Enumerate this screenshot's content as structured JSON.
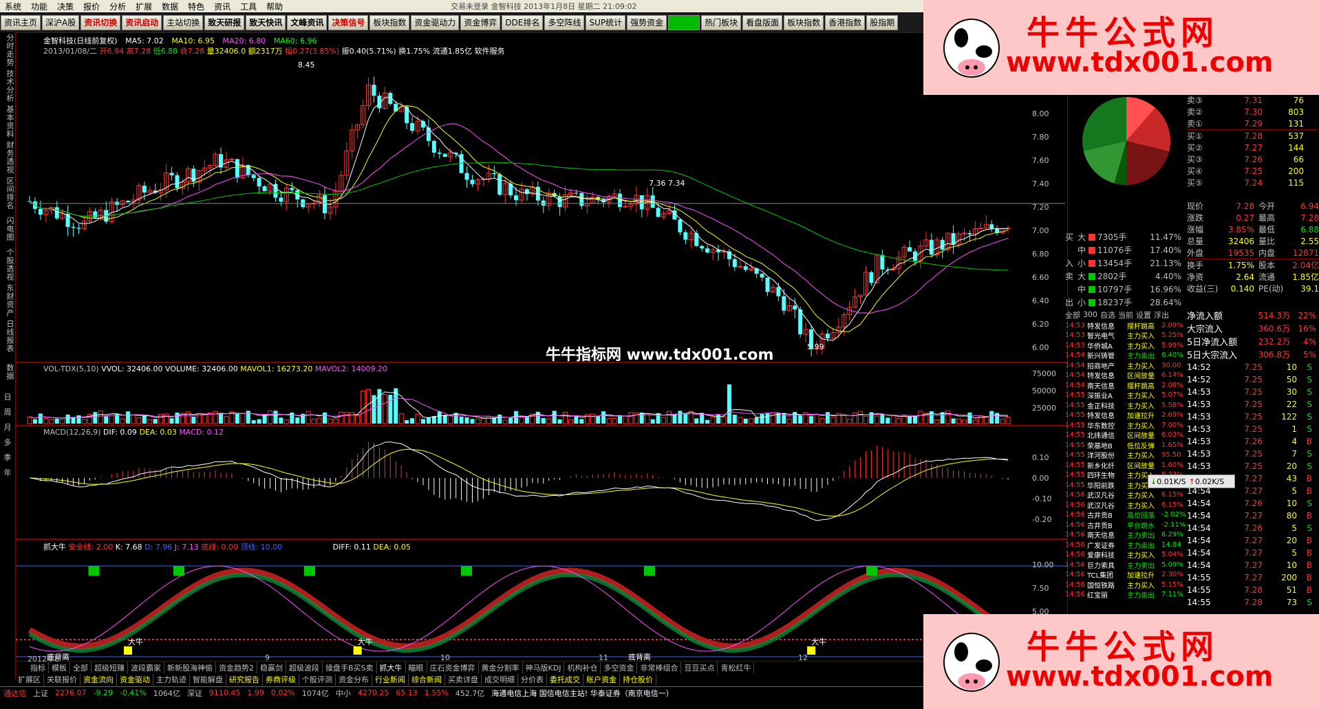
{
  "menu": [
    "系统",
    "功能",
    "决策",
    "报价",
    "分析",
    "扩展",
    "数据",
    "特色",
    "资讯",
    "工具",
    "帮助"
  ],
  "window_title": "交易未登录  金智科技 2013年1月8日 星期二 21:09:02",
  "toolbar": [
    {
      "label": "资讯主页",
      "style": ""
    },
    {
      "label": "深沪A股",
      "style": ""
    },
    {
      "label": "资讯切换",
      "style": "red"
    },
    {
      "label": "资讯启动",
      "style": "red"
    },
    {
      "label": "主站切换",
      "style": ""
    },
    {
      "label": "致天研报",
      "style": "bold"
    },
    {
      "label": "致天快讯",
      "style": "bold"
    },
    {
      "label": "文峰资讯",
      "style": "bold"
    },
    {
      "label": "决策信号",
      "style": "red"
    },
    {
      "label": "板块指数",
      "style": ""
    },
    {
      "label": "资金驱动力",
      "style": ""
    },
    {
      "label": "资金博弈",
      "style": ""
    },
    {
      "label": "DDE排名",
      "style": ""
    },
    {
      "label": "多空阵线",
      "style": ""
    },
    {
      "label": "SUP统计",
      "style": ""
    },
    {
      "label": "强势资金",
      "style": ""
    },
    {
      "label": "",
      "style": "green"
    },
    {
      "label": "热门板块",
      "style": ""
    },
    {
      "label": "看盘版面",
      "style": ""
    },
    {
      "label": "板块指数",
      "style": ""
    },
    {
      "label": "香港指数",
      "style": ""
    },
    {
      "label": "股指期",
      "style": ""
    }
  ],
  "left_tools": [
    "分时走势",
    "技术分析",
    "基本资料",
    "财务透视",
    "区间排名",
    "闪电图",
    "个股透视",
    "东财资产",
    "日线报表",
    "数据"
  ],
  "left_period": [
    "日",
    "周",
    "月",
    "多",
    "季",
    "年"
  ],
  "kline": {
    "title": "金智科技(日线前复权)",
    "ma5": "MA5: 7.02",
    "ma10": "MA10: 6.95",
    "ma20": "MA20: 6.80",
    "ma60": "MA60: 6.96",
    "line2a": "2013/01/08/二",
    "open": "开6.94",
    "high": "高7.28",
    "low": "低6.88",
    "close": "收7.28",
    "vol": "量32406.0",
    "amount": "额2317万",
    "change": "幅0.27(3.85%)",
    "tail": "振0.40(5.71%) 换1.75% 流通1.85亿 软件服务",
    "label_high": "8.45",
    "label_mid": "7.36  7.34",
    "label_low": "5.99",
    "yaxis": [
      "8.00",
      "7.80",
      "7.60",
      "7.40",
      "7.20",
      "7.00",
      "6.80",
      "6.60",
      "6.40",
      "6.20",
      "6.00"
    ]
  },
  "center_watermark": "牛牛指标网 www.tdx001.com",
  "vol": {
    "title": "VOL-TDX(5,10)",
    "v1": "VVOL: 32406.00",
    "v2": "VOLUME: 32406.00",
    "v3": "MAVOL1: 16273.20",
    "v4": "MAVOL2: 14009.20",
    "yaxis": [
      "75000",
      "50000",
      "25000"
    ]
  },
  "macd": {
    "title": "MACD(12,26,9)",
    "dif": "DIF: 0.09",
    "dea": "DEA: 0.03",
    "macd": "MACD: 0.12",
    "yaxis": [
      "0.10",
      "0.00",
      "-0.10",
      "-0.20"
    ]
  },
  "kdj": {
    "title": "抓大牛",
    "safe": "安全线: 2.00",
    "k": "K: 7.68",
    "d": "D: 7.96",
    "j": "J: 7.13",
    "bottom": "底线: 0.00",
    "top": "顶线: 10.00",
    "diff": "DIFF: 0.11",
    "dea": "DEA: 0.05",
    "yaxis": [
      "10.00",
      "7.50",
      "5.00"
    ],
    "sig_bottom": "底背离",
    "sig_buy": "大牛",
    "sig_sell": "卖"
  },
  "xaxis": [
    "2012年8",
    "9",
    "10",
    "11",
    "12"
  ],
  "tabs1": [
    "指标",
    "模板",
    "全部",
    "超级短赚",
    "波段霸家",
    "新新股海神偷",
    "资金趋势2",
    "稳赢剑",
    "超级波段",
    "操盘手B买S卖",
    "抓大牛",
    "瞄眼",
    "庄石资金博弈",
    "黄金分割率",
    "神马版KDJ",
    "机构补仓",
    "多空资金",
    "非常棒组合",
    "豆豆买点",
    "青松红牛"
  ],
  "tabs2": [
    "扩展区",
    "关联报价",
    "资金流向",
    "资金驱动",
    "主力轨迹",
    "智能解盘",
    "研究报告",
    "券商评级",
    "个股评测",
    "资金分布",
    "行业新闻",
    "综合新闻",
    "买卖详盘",
    "成交明细",
    "分价表",
    "委托成交",
    "账户资金",
    "持仓股价"
  ],
  "status": [
    {
      "t": "通达信",
      "c": "red"
    },
    {
      "t": "上证",
      "c": ""
    },
    {
      "t": "2276.07",
      "c": "red"
    },
    {
      "t": "-9.29",
      "c": "green"
    },
    {
      "t": "-0.41%",
      "c": "green"
    },
    {
      "t": "1064亿",
      "c": ""
    },
    {
      "t": "深证",
      "c": ""
    },
    {
      "t": "9110.45",
      "c": "red"
    },
    {
      "t": "1.99",
      "c": "red"
    },
    {
      "t": "0.02%",
      "c": "red"
    },
    {
      "t": "1074亿",
      "c": ""
    },
    {
      "t": "中小",
      "c": ""
    },
    {
      "t": "4270.25",
      "c": "red"
    },
    {
      "t": "65.13",
      "c": "red"
    },
    {
      "t": "1.55%",
      "c": "red"
    },
    {
      "t": "452.7亿",
      "c": ""
    },
    {
      "t": "海通电信上海 国信电信主站! 华泰证券（南京电信一）",
      "c": "white"
    }
  ],
  "pie": {
    "colors": [
      "#ff5050",
      "#c82828",
      "#781414",
      "#0a5a0a",
      "#329632",
      "#14781e"
    ]
  },
  "orderbook": {
    "sell": [
      {
        "l": "卖③",
        "p": "7.31",
        "v": "76"
      },
      {
        "l": "卖②",
        "p": "7.30",
        "v": "803"
      },
      {
        "l": "卖①",
        "p": "7.29",
        "v": "131"
      }
    ],
    "buy": [
      {
        "l": "买①",
        "p": "7.28",
        "v": "537"
      },
      {
        "l": "买②",
        "p": "7.27",
        "v": "144"
      },
      {
        "l": "买③",
        "p": "7.26",
        "v": "66"
      },
      {
        "l": "买④",
        "p": "7.25",
        "v": "200"
      },
      {
        "l": "买⑤",
        "p": "7.24",
        "v": "115"
      }
    ]
  },
  "quote": [
    [
      "现价",
      "7.28",
      "今开",
      "6.94"
    ],
    [
      "涨跌",
      "0.27",
      "最高",
      "7.28"
    ],
    [
      "涨幅",
      "3.85%",
      "最低",
      "6.88"
    ],
    [
      "总量",
      "32406",
      "量比",
      "2.55"
    ],
    [
      "外盘",
      "19535",
      "内盘",
      "12871"
    ],
    [
      "换手",
      "1.75%",
      "股本",
      "2.04亿"
    ],
    [
      "净资",
      "2.64",
      "流通",
      "1.85亿"
    ],
    [
      "收益(三)",
      "0.140",
      "PE(动)",
      "39.1"
    ]
  ],
  "flows": [
    {
      "side": "买",
      "lv": "大",
      "v": "7305手",
      "p": "11.47%"
    },
    {
      "side": "",
      "lv": "中",
      "v": "11076手",
      "p": "17.40%"
    },
    {
      "side": "入",
      "lv": "小",
      "v": "13454手",
      "p": "21.13%"
    },
    {
      "side": "卖",
      "lv": "大",
      "v": "2802手",
      "p": "4.40%"
    },
    {
      "side": "",
      "lv": "中",
      "v": "10797手",
      "p": "16.96%"
    },
    {
      "side": "出",
      "lv": "小",
      "v": "18237手",
      "p": "28.64%"
    }
  ],
  "flowsum": [
    {
      "l": "净流入额",
      "v": "514.3万",
      "p": "22%"
    },
    {
      "l": "大宗流入",
      "v": "360.6万",
      "p": "16%"
    },
    {
      "l": "5日净流入额",
      "v": "232.2万",
      "p": "4%"
    },
    {
      "l": "5日大宗流入",
      "v": "306.8万",
      "p": "5%"
    }
  ],
  "radar_tabs": [
    "全部",
    "300",
    "自选",
    "当前",
    "设置",
    "浮出"
  ],
  "radar": [
    [
      "14:53",
      "特发信息",
      "摆杆跳高",
      "2.09%"
    ],
    [
      "14:53",
      "智光电气",
      "主力买入",
      "5.25%"
    ],
    [
      "14:53",
      "华侨城A",
      "主力买入",
      "5.99%"
    ],
    [
      "14:54",
      "新兴铸管",
      "主力卖出",
      "6.40%"
    ],
    [
      "14:54",
      "招商地产",
      "主力买入",
      "30.00"
    ],
    [
      "14:54",
      "特发信息",
      "区间放量",
      "6.14%"
    ],
    [
      "14:54",
      "南天信息",
      "摆杆跳高",
      "2.08%"
    ],
    [
      "14:55",
      "深振业A",
      "主力买入",
      "5.07%"
    ],
    [
      "14:55",
      "金正科技",
      "主力买入",
      "5.58%"
    ],
    [
      "14:55",
      "特发信息",
      "加速拉升",
      "2.69%"
    ],
    [
      "14:55",
      "华东数控",
      "主力买入",
      "7.00%"
    ],
    [
      "14:55",
      "北纬通信",
      "区间放量",
      "6.03%"
    ],
    [
      "14:55",
      "荣基地B",
      "低位反弹",
      "1.65%"
    ],
    [
      "14:55",
      "洋河股份",
      "主力买入",
      "95.50"
    ],
    [
      "14:55",
      "新乡化纤",
      "区间放量",
      "1.60%"
    ],
    [
      "14:55",
      "四环生物",
      "主力买入",
      "5.23%"
    ],
    [
      "14:55",
      "华阳前跌",
      "主力买入",
      "6.10%"
    ],
    [
      "14:56",
      "武汉凡谷",
      "主力买入",
      "6.15%"
    ],
    [
      "14:56",
      "武汉凡谷",
      "主力买入",
      "6.15%"
    ],
    [
      "14:56",
      "古井贡B",
      "高位回落",
      "-2.02%"
    ],
    [
      "14:56",
      "古井贡B",
      "平台跳水",
      "-2.11%"
    ],
    [
      "14:56",
      "南天信息",
      "主力卖出",
      "6.29%"
    ],
    [
      "14:56",
      "广发证券",
      "主力卖出",
      "14.84"
    ],
    [
      "14:56",
      "爱康科技",
      "主力买入",
      "5.04%"
    ],
    [
      "14:56",
      "巨力索具",
      "主力卖出",
      "5.09%"
    ],
    [
      "14:56",
      "TCL集团",
      "加速拉升",
      "2.30%"
    ],
    [
      "14:56",
      "国恒铁路",
      "主力买入",
      "5.15%"
    ],
    [
      "14:56",
      "红宝丽",
      "主力卖出",
      "7.11%"
    ]
  ],
  "ticks": [
    [
      "14:52",
      "7.25",
      "10",
      "S"
    ],
    [
      "14:52",
      "7.25",
      "50",
      "S"
    ],
    [
      "14:53",
      "7.25",
      "30",
      "S"
    ],
    [
      "14:53",
      "7.25",
      "22",
      "S"
    ],
    [
      "14:53",
      "7.25",
      "122",
      "S"
    ],
    [
      "14:53",
      "7.25",
      "1",
      "S"
    ],
    [
      "14:53",
      "7.26",
      "4",
      "B"
    ],
    [
      "14:53",
      "7.25",
      "7",
      "S"
    ],
    [
      "14:53",
      "7.25",
      "20",
      "S"
    ],
    [
      "14:53",
      "7.27",
      "43",
      "B"
    ],
    [
      "14:54",
      "7.27",
      "5",
      "B"
    ],
    [
      "14:54",
      "7.26",
      "10",
      "S"
    ],
    [
      "14:54",
      "7.27",
      "80",
      "B"
    ],
    [
      "14:54",
      "7.26",
      "5",
      "S"
    ],
    [
      "14:54",
      "7.27",
      "20",
      "B"
    ],
    [
      "14:54",
      "7.27",
      "5",
      "B"
    ],
    [
      "14:54",
      "7.27",
      "10",
      "B"
    ],
    [
      "14:55",
      "7.27",
      "200",
      "B"
    ],
    [
      "14:55",
      "7.28",
      "51",
      "B"
    ],
    [
      "14:55",
      "7.28",
      "73",
      "S"
    ]
  ],
  "speed": {
    "down": "0.01K/S",
    "up": "0.02K/S"
  },
  "wm_text1": "牛牛公式网",
  "wm_text2": "www.tdx001.com"
}
